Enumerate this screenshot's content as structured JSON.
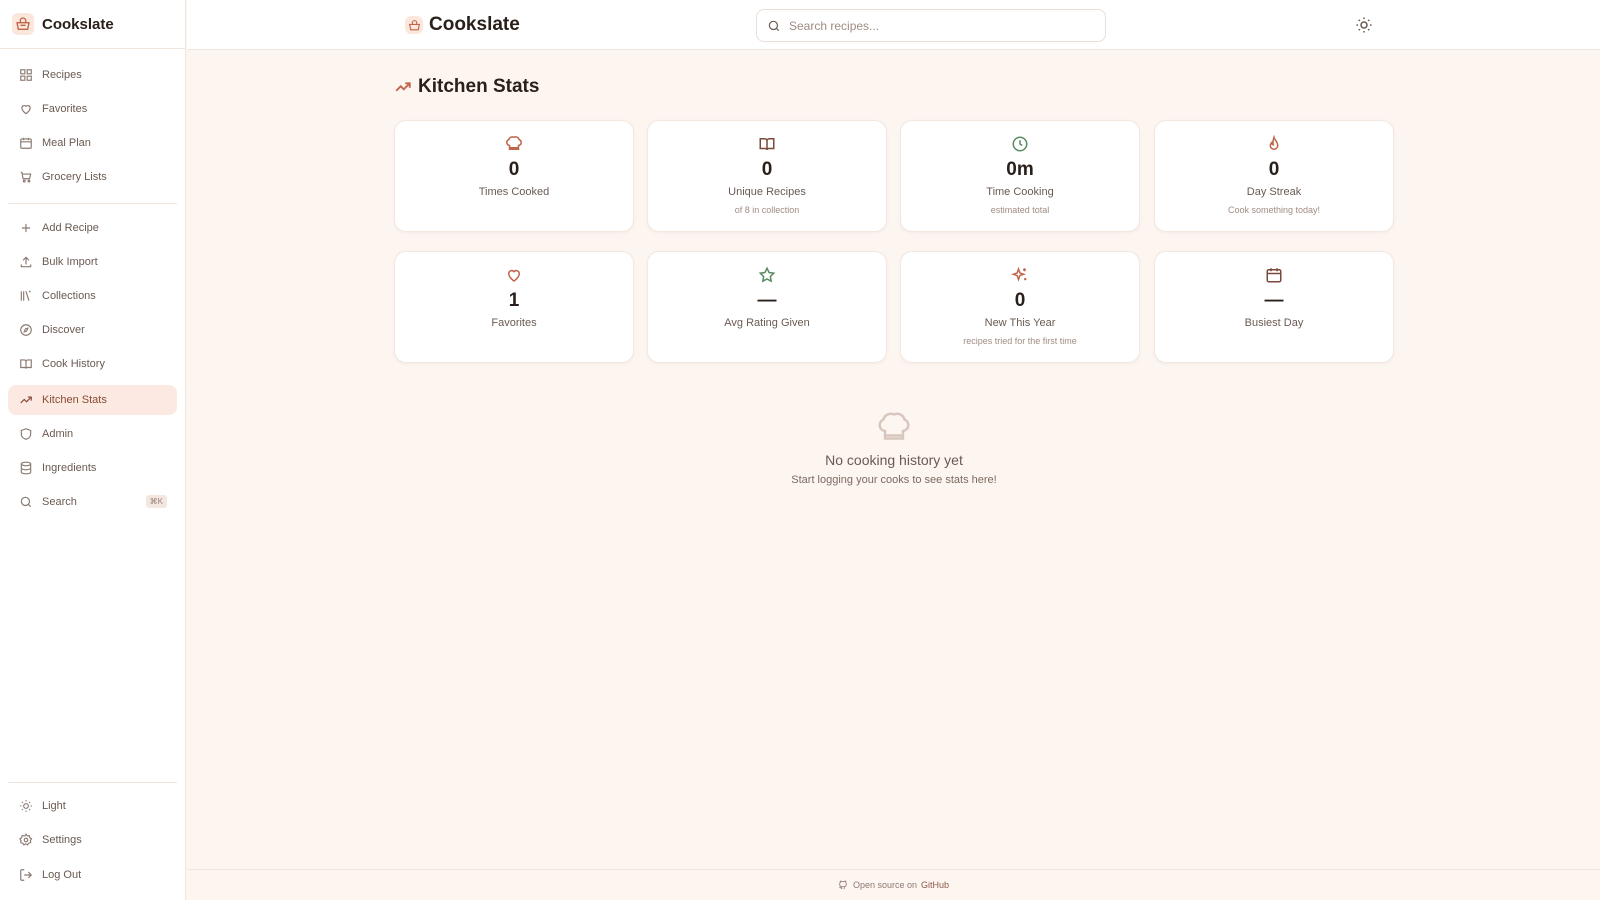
{
  "app": {
    "name": "Cookslate"
  },
  "colors": {
    "accent": "#c0644a",
    "background": "#fdf5f0",
    "active_bg": "#fbe9e2",
    "green_icon": "#5a8a63"
  },
  "sidebar": {
    "items": [
      {
        "label": "Recipes",
        "icon": "grid-icon"
      },
      {
        "label": "Favorites",
        "icon": "heart-icon"
      },
      {
        "label": "Meal Plan",
        "icon": "calendar-icon"
      },
      {
        "label": "Grocery Lists",
        "icon": "cart-icon"
      },
      {
        "label": "Add Recipe",
        "icon": "plus-icon"
      },
      {
        "label": "Bulk Import",
        "icon": "upload-icon"
      },
      {
        "label": "Collections",
        "icon": "library-icon"
      },
      {
        "label": "Discover",
        "icon": "compass-icon"
      },
      {
        "label": "Cook History",
        "icon": "book-icon"
      },
      {
        "label": "Kitchen Stats",
        "icon": "trending-up-icon",
        "active": true
      },
      {
        "label": "Admin",
        "icon": "shield-icon"
      },
      {
        "label": "Ingredients",
        "icon": "database-icon"
      },
      {
        "label": "Search",
        "icon": "search-icon",
        "shortcut": "⌘K"
      }
    ],
    "bottom": [
      {
        "label": "Light",
        "icon": "sun-icon"
      },
      {
        "label": "Settings",
        "icon": "gear-icon"
      },
      {
        "label": "Log Out",
        "icon": "logout-icon"
      }
    ]
  },
  "topbar": {
    "brand": "Cookslate",
    "search_placeholder": "Search recipes..."
  },
  "page": {
    "title": "Kitchen Stats"
  },
  "stats": [
    {
      "value": "0",
      "label": "Times Cooked",
      "sub": "",
      "icon": "chef-hat-icon"
    },
    {
      "value": "0",
      "label": "Unique Recipes",
      "sub": "of 8 in collection",
      "icon": "open-book-icon"
    },
    {
      "value": "0m",
      "label": "Time Cooking",
      "sub": "estimated total",
      "icon": "clock-icon"
    },
    {
      "value": "0",
      "label": "Day Streak",
      "sub": "Cook something today!",
      "icon": "flame-icon"
    },
    {
      "value": "1",
      "label": "Favorites",
      "sub": "",
      "icon": "heart-icon"
    },
    {
      "value": "—",
      "label": "Avg Rating Given",
      "sub": "",
      "icon": "star-icon"
    },
    {
      "value": "0",
      "label": "New This Year",
      "sub": "recipes tried for the first time",
      "icon": "sparkles-icon"
    },
    {
      "value": "—",
      "label": "Busiest Day",
      "sub": "",
      "icon": "calendar-icon"
    }
  ],
  "empty_state": {
    "title": "No cooking history yet",
    "subtitle": "Start logging your cooks to see stats here!",
    "icon": "chef-hat-icon"
  },
  "footer": {
    "text": "Open source on",
    "link": "GitHub",
    "icon": "github-icon"
  }
}
